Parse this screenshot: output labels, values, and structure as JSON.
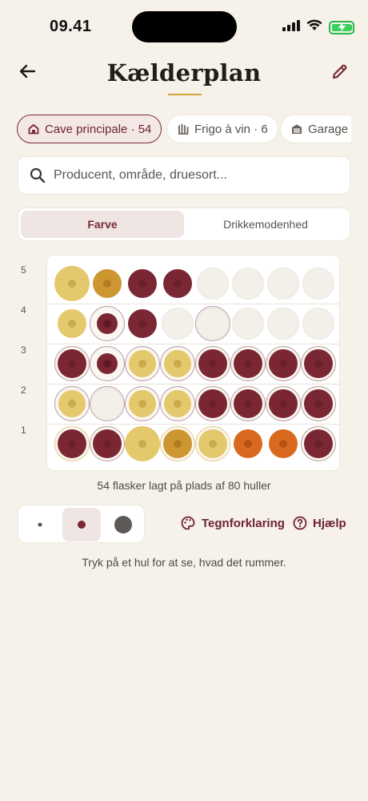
{
  "status_bar": {
    "time": "09.41",
    "icons": [
      "signal-icon",
      "wifi-icon",
      "battery-charging-icon"
    ]
  },
  "header": {
    "title": "Kælderplan",
    "back_icon": "arrow-left-icon",
    "edit_icon": "pencil-icon"
  },
  "locations": [
    {
      "label": "Cave principale · 54",
      "icon": "house-icon",
      "active": true
    },
    {
      "label": "Frigo à vin · 6",
      "icon": "fridge-icon",
      "active": false
    },
    {
      "label": "Garage · ",
      "icon": "garage-icon",
      "active": false
    }
  ],
  "search": {
    "placeholder": "Producent, område, druesort...",
    "value": "",
    "icon": "search-icon"
  },
  "view_tabs": [
    {
      "label": "Farve",
      "active": true
    },
    {
      "label": "Drikkemodenhed",
      "active": false
    }
  ],
  "grid": {
    "row_labels": [
      "5",
      "4",
      "3",
      "2",
      "1"
    ],
    "rows": [
      [
        "white-large",
        "gold",
        "red",
        "red",
        "empty",
        "empty",
        "empty",
        "empty"
      ],
      [
        "white",
        "red-small-ring",
        "red",
        "empty",
        "empty-ring",
        "empty",
        "empty",
        "empty"
      ],
      [
        "red-ring",
        "red-small-ring",
        "white-ring",
        "white-ring",
        "red-ring",
        "red-ring",
        "red-ring",
        "red-ring"
      ],
      [
        "white-ring",
        "empty-ring",
        "white-ring",
        "white-ring",
        "red-ring",
        "red-ring",
        "red-ring",
        "red-ring"
      ],
      [
        "red-goldring",
        "red-ring",
        "white-large",
        "gold-goldring",
        "white-goldring",
        "orange",
        "orange",
        "red-ring"
      ]
    ]
  },
  "colors": {
    "red": "#7a2733",
    "white_wine": "#e4c86c",
    "gold": "#cd9630",
    "orange": "#d9691f",
    "empty": "#f3f0ea",
    "accent": "#6e2230"
  },
  "count_text": "54 flasker lagt på plads af 80 huller",
  "size_options": [
    {
      "name": "small",
      "active": false
    },
    {
      "name": "medium",
      "active": true
    },
    {
      "name": "large",
      "active": false
    }
  ],
  "legend_label": "Tegnforklaring",
  "help_label": "Hjælp",
  "hint": "Tryk på et hul for at se, hvad det rummer."
}
